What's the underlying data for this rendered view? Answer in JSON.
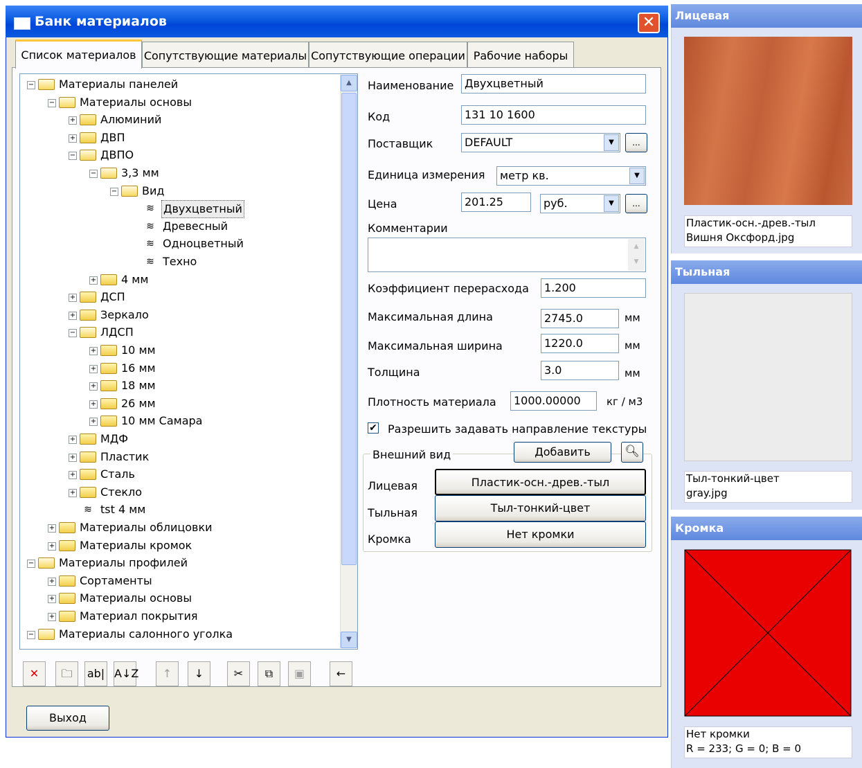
{
  "window": {
    "title": "Банк материалов",
    "close_glyph": "✕"
  },
  "tabs": [
    "Список материалов",
    "Сопутствующие материалы",
    "Сопутствующие операции",
    "Рабочие наборы"
  ],
  "tree": [
    {
      "label": "Материалы панелей",
      "level": 0,
      "expander": "−",
      "icon": "folder-open"
    },
    {
      "label": "Материалы основы",
      "level": 1,
      "expander": "−",
      "icon": "folder-open"
    },
    {
      "label": "Алюминий",
      "level": 2,
      "expander": "+",
      "icon": "folder"
    },
    {
      "label": "ДВП",
      "level": 2,
      "expander": "+",
      "icon": "folder"
    },
    {
      "label": "ДВПО",
      "level": 2,
      "expander": "−",
      "icon": "folder-open"
    },
    {
      "label": "3,3 мм",
      "level": 3,
      "expander": "−",
      "icon": "folder-open"
    },
    {
      "label": "Вид",
      "level": 4,
      "expander": "−",
      "icon": "folder-open"
    },
    {
      "label": "Двухцветный",
      "level": 5,
      "expander": "",
      "icon": "material",
      "selected": true
    },
    {
      "label": "Древесный",
      "level": 5,
      "expander": "",
      "icon": "material"
    },
    {
      "label": "Одноцветный",
      "level": 5,
      "expander": "",
      "icon": "material"
    },
    {
      "label": "Техно",
      "level": 5,
      "expander": "",
      "icon": "material"
    },
    {
      "label": "4 мм",
      "level": 3,
      "expander": "+",
      "icon": "folder"
    },
    {
      "label": "ДСП",
      "level": 2,
      "expander": "+",
      "icon": "folder"
    },
    {
      "label": "Зеркало",
      "level": 2,
      "expander": "+",
      "icon": "folder"
    },
    {
      "label": "ЛДСП",
      "level": 2,
      "expander": "−",
      "icon": "folder-open"
    },
    {
      "label": "10 мм",
      "level": 3,
      "expander": "+",
      "icon": "folder"
    },
    {
      "label": "16 мм",
      "level": 3,
      "expander": "+",
      "icon": "folder"
    },
    {
      "label": "18 мм",
      "level": 3,
      "expander": "+",
      "icon": "folder"
    },
    {
      "label": "26 мм",
      "level": 3,
      "expander": "+",
      "icon": "folder"
    },
    {
      "label": "10 мм Самара",
      "level": 3,
      "expander": "+",
      "icon": "folder"
    },
    {
      "label": "МДФ",
      "level": 2,
      "expander": "+",
      "icon": "folder"
    },
    {
      "label": "Пластик",
      "level": 2,
      "expander": "+",
      "icon": "folder"
    },
    {
      "label": "Сталь",
      "level": 2,
      "expander": "+",
      "icon": "folder"
    },
    {
      "label": "Стекло",
      "level": 2,
      "expander": "+",
      "icon": "folder"
    },
    {
      "label": "tst 4 мм",
      "level": 2,
      "expander": "",
      "icon": "material"
    },
    {
      "label": "Материалы облицовки",
      "level": 1,
      "expander": "+",
      "icon": "folder"
    },
    {
      "label": "Материалы кромок",
      "level": 1,
      "expander": "+",
      "icon": "folder"
    },
    {
      "label": "Материалы профилей",
      "level": 0,
      "expander": "−",
      "icon": "folder-open"
    },
    {
      "label": "Сортаменты",
      "level": 1,
      "expander": "+",
      "icon": "folder"
    },
    {
      "label": "Материалы основы",
      "level": 1,
      "expander": "+",
      "icon": "folder"
    },
    {
      "label": "Материал покрытия",
      "level": 1,
      "expander": "+",
      "icon": "folder"
    },
    {
      "label": "Материалы салонного уголка",
      "level": 0,
      "expander": "−",
      "icon": "folder-open"
    }
  ],
  "toolbar": [
    {
      "name": "delete",
      "glyph": "✕",
      "color": "#e00000"
    },
    {
      "name": "new-folder",
      "glyph": "🗀",
      "color": "#000000"
    },
    {
      "name": "rename",
      "glyph": "ab|",
      "color": "#000000"
    },
    {
      "name": "sort",
      "glyph": "A↓Z",
      "color": "#000000"
    },
    {
      "name": "move-up",
      "glyph": "↑",
      "color": "#a0a0a0"
    },
    {
      "name": "move-down",
      "glyph": "↓",
      "color": "#000000"
    },
    {
      "name": "cut",
      "glyph": "✂",
      "color": "#000000"
    },
    {
      "name": "copy",
      "glyph": "⧉",
      "color": "#000000"
    },
    {
      "name": "paste",
      "glyph": "▣",
      "color": "#a0a0a0"
    },
    {
      "name": "back",
      "glyph": "←",
      "color": "#000000"
    }
  ],
  "form": {
    "name_label": "Наименование",
    "name_value": "Двухцветный",
    "code_label": "Код",
    "code_value": "131 10 1600",
    "supplier_label": "Поставщик",
    "supplier_value": "DEFAULT",
    "unit_label": "Единица измерения",
    "unit_value": "метр кв.",
    "price_label": "Цена",
    "price_value": "201.25",
    "currency_value": "руб.",
    "comments_label": "Комментарии",
    "comments_value": "",
    "overuse_label": "Коэффициент перерасхода",
    "overuse_value": "1.200",
    "max_length_label": "Максимальная длина",
    "max_length_value": "2745.0",
    "max_width_label": "Максимальная ширина",
    "max_width_value": "1220.0",
    "thickness_label": "Толщина",
    "thickness_value": "3.0",
    "unit_mm": "мм",
    "density_label": "Плотность материала",
    "density_value": "1000.00000",
    "density_unit": "кг / м3",
    "texture_direction_label": "Разрешить задавать направление текстуры",
    "texture_direction_checked": true,
    "ellipsis": "..."
  },
  "appearance": {
    "group_label": "Внешний вид",
    "add_label": "Добавить",
    "front_label": "Лицевая",
    "front_value": "Пластик-осн.-древ.-тыл",
    "back_label": "Тыльная",
    "back_value": "Тыл-тонкий-цвет",
    "edge_label": "Кромка",
    "edge_value": "Нет кромки"
  },
  "exit_label": "Выход",
  "preview": {
    "front_title": "Лицевая",
    "front_caption1": "Пластик-осн.-древ.-тыл",
    "front_caption2": "Вишня Оксфорд.jpg",
    "back_title": "Тыльная",
    "back_caption1": "Тыл-тонкий-цвет",
    "back_caption2": "gray.jpg",
    "edge_title": "Кромка",
    "edge_caption1": "Нет кромки",
    "edge_caption2": "R = 233; G = 0; B = 0",
    "edge_color": "#e90000",
    "back_color": "#ececec",
    "wood_color": "#c8643c"
  }
}
